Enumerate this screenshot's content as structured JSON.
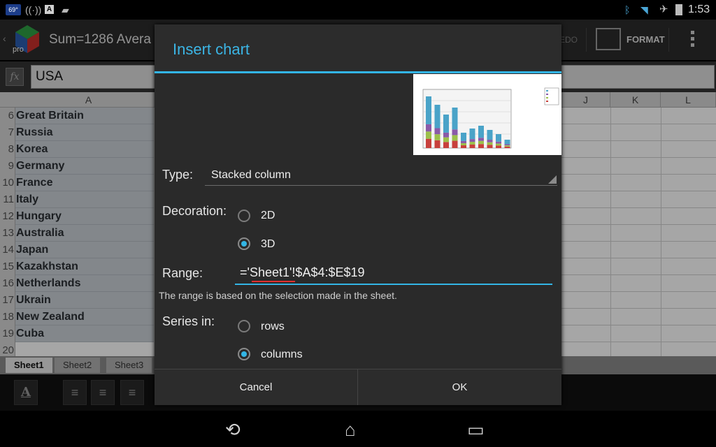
{
  "status_bar": {
    "temp": "69°",
    "time": "1:53",
    "icons": [
      "radio-icon",
      "a-icon",
      "android-icon",
      "bluetooth-icon",
      "wifi-icon",
      "airplane-icon",
      "battery-icon"
    ]
  },
  "action_bar": {
    "sum": "Sum=1286   Avera",
    "redo": "EDO",
    "format": "FORMAT",
    "logo_text": "pro"
  },
  "formula_bar": {
    "fx": "fx",
    "value": "USA"
  },
  "grid": {
    "columns": [
      "A",
      "J",
      "K",
      "L"
    ],
    "rows": [
      {
        "num": "6",
        "value": "Great Britain"
      },
      {
        "num": "7",
        "value": "Russia"
      },
      {
        "num": "8",
        "value": "Korea"
      },
      {
        "num": "9",
        "value": "Germany"
      },
      {
        "num": "10",
        "value": "France"
      },
      {
        "num": "11",
        "value": "Italy"
      },
      {
        "num": "12",
        "value": "Hungary"
      },
      {
        "num": "13",
        "value": "Australia"
      },
      {
        "num": "14",
        "value": "Japan"
      },
      {
        "num": "15",
        "value": "Kazakhstan"
      },
      {
        "num": "16",
        "value": "Netherlands"
      },
      {
        "num": "17",
        "value": "Ukrain"
      },
      {
        "num": "18",
        "value": "New Zealand"
      },
      {
        "num": "19",
        "value": "Cuba"
      },
      {
        "num": "20",
        "value": ""
      }
    ]
  },
  "sheet_tabs": [
    "Sheet1",
    "Sheet2",
    "Sheet3"
  ],
  "toolbar": {
    "font_btn": "A"
  },
  "dialog": {
    "title": "Insert chart",
    "type_label": "Type:",
    "type_value": "Stacked column",
    "decoration_label": "Decoration:",
    "decoration_options": [
      "2D",
      "3D"
    ],
    "decoration_selected": "3D",
    "range_label": "Range:",
    "range_value": "='Sheet1'!$A$4:$E$19",
    "range_hint": "The range is based on the selection made in the sheet.",
    "series_label": "Series in:",
    "series_options": [
      "rows",
      "columns"
    ],
    "series_selected": "columns",
    "cancel": "Cancel",
    "ok": "OK"
  },
  "colors": {
    "accent": "#33b5e5",
    "dialog_bg": "#2c2c2c",
    "cell_selected": "#c9cfd6"
  }
}
